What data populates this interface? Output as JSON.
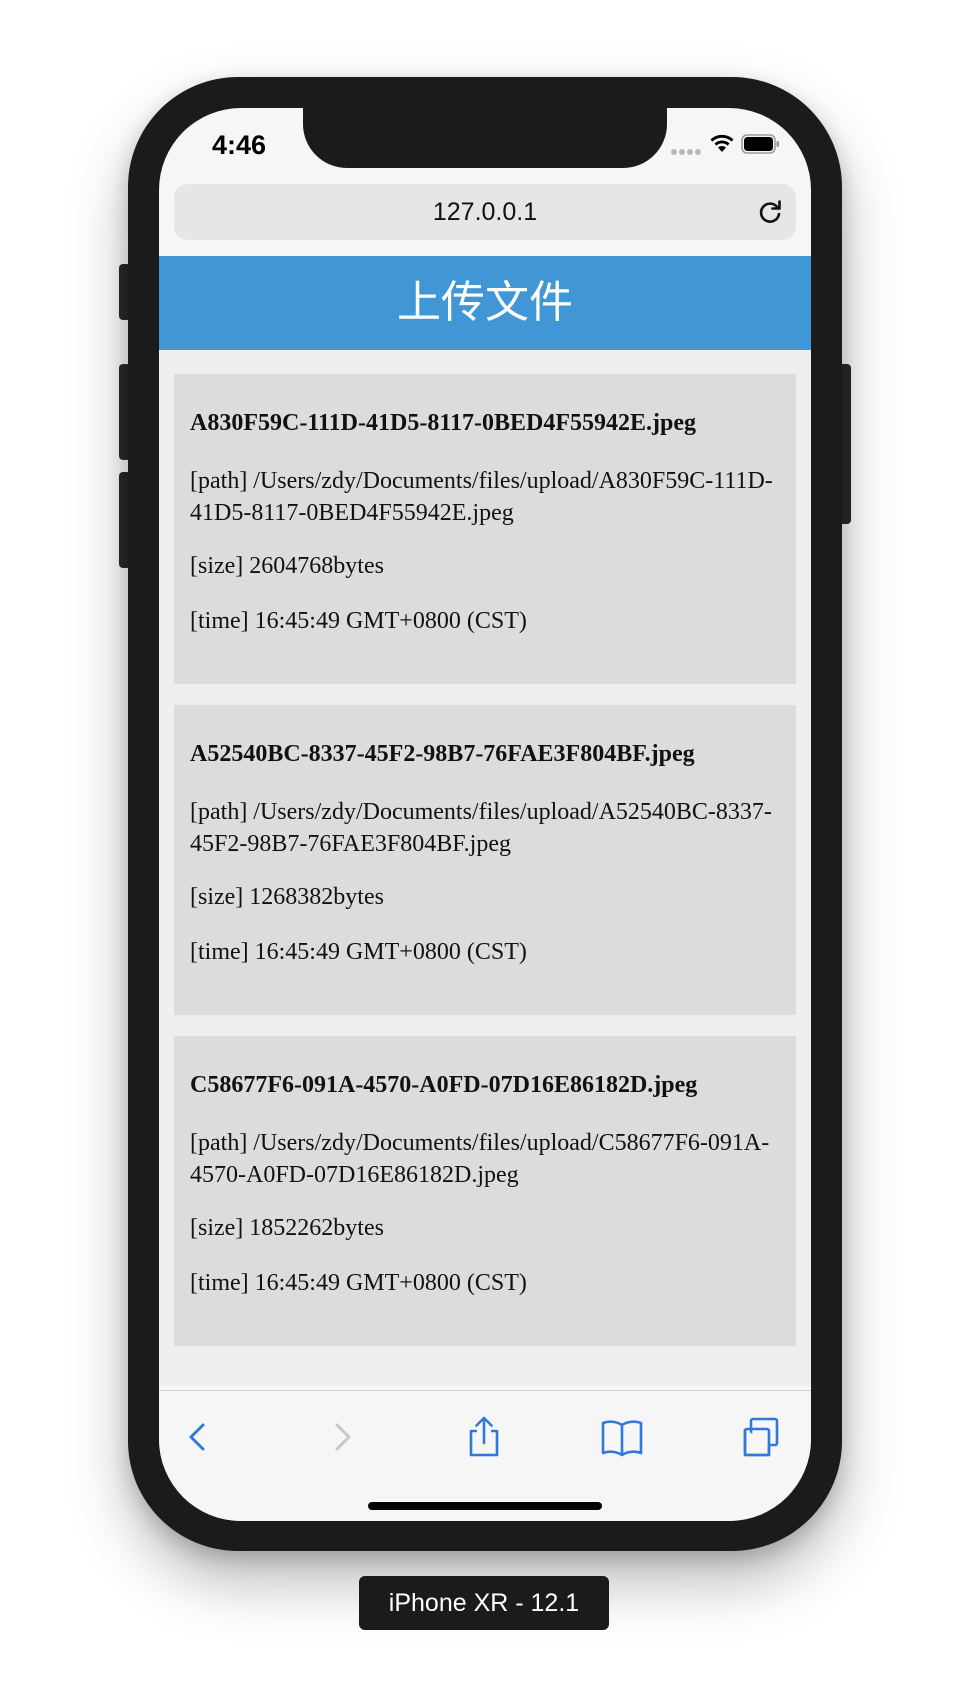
{
  "status_bar": {
    "time": "4:46"
  },
  "browser": {
    "url": "127.0.0.1"
  },
  "page": {
    "title": "上传文件",
    "files": [
      {
        "name": "A830F59C-111D-41D5-8117-0BED4F55942E.jpeg",
        "path": "[path] /Users/zdy/Documents/files/upload/A830F59C-111D-41D5-8117-0BED4F55942E.jpeg",
        "size": "[size] 2604768bytes",
        "time": "[time] 16:45:49 GMT+0800 (CST)"
      },
      {
        "name": "A52540BC-8337-45F2-98B7-76FAE3F804BF.jpeg",
        "path": "[path] /Users/zdy/Documents/files/upload/A52540BC-8337-45F2-98B7-76FAE3F804BF.jpeg",
        "size": "[size] 1268382bytes",
        "time": "[time] 16:45:49 GMT+0800 (CST)"
      },
      {
        "name": "C58677F6-091A-4570-A0FD-07D16E86182D.jpeg",
        "path": "[path] /Users/zdy/Documents/files/upload/C58677F6-091A-4570-A0FD-07D16E86182D.jpeg",
        "size": "[size] 1852262bytes",
        "time": "[time] 16:45:49 GMT+0800 (CST)"
      }
    ]
  },
  "toolbar": {
    "icons": [
      "back-icon",
      "forward-icon",
      "share-icon",
      "bookmarks-icon",
      "tabs-icon"
    ],
    "accent_color": "#2f7ad9",
    "disabled_color": "#c7c7cc"
  },
  "device_label": "iPhone XR - 12.1"
}
